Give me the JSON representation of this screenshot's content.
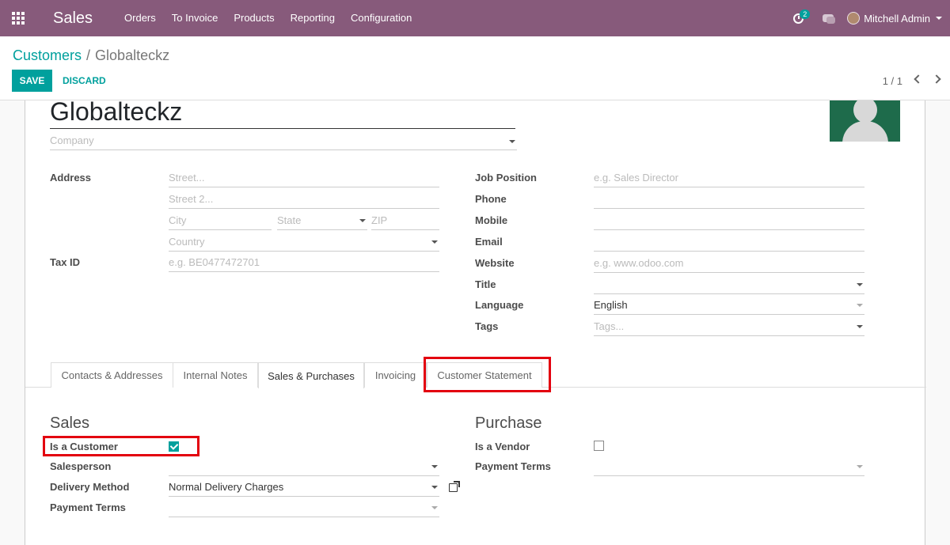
{
  "navbar": {
    "brand": "Sales",
    "menu": [
      "Orders",
      "To Invoice",
      "Products",
      "Reporting",
      "Configuration"
    ],
    "activity_count": "2",
    "user_name": "Mitchell Admin",
    "bg_color": "#875a7b"
  },
  "control_panel": {
    "breadcrumb_parent": "Customers",
    "breadcrumb_sep": "/",
    "breadcrumb_current": "Globalteckz",
    "save_label": "SAVE",
    "discard_label": "DISCARD",
    "pager": "1 / 1"
  },
  "form": {
    "name": "Globalteckz",
    "company_placeholder": "Company",
    "address_label": "Address",
    "street_placeholder": "Street...",
    "street2_placeholder": "Street 2...",
    "city_placeholder": "City",
    "state_placeholder": "State",
    "zip_placeholder": "ZIP",
    "country_placeholder": "Country",
    "tax_id_label": "Tax ID",
    "tax_id_placeholder": "e.g. BE0477472701",
    "job_position_label": "Job Position",
    "job_position_placeholder": "e.g. Sales Director",
    "phone_label": "Phone",
    "mobile_label": "Mobile",
    "email_label": "Email",
    "website_label": "Website",
    "website_placeholder": "e.g. www.odoo.com",
    "title_label": "Title",
    "language_label": "Language",
    "language_value": "English",
    "tags_label": "Tags",
    "tags_placeholder": "Tags..."
  },
  "tabs": [
    "Contacts & Addresses",
    "Internal Notes",
    "Sales & Purchases",
    "Invoicing",
    "Customer Statement"
  ],
  "active_tab": "Sales & Purchases",
  "sales": {
    "title": "Sales",
    "is_customer_label": "Is a Customer",
    "is_customer": true,
    "salesperson_label": "Salesperson",
    "delivery_method_label": "Delivery Method",
    "delivery_method_value": "Normal Delivery Charges",
    "payment_terms_label": "Payment Terms"
  },
  "purchase": {
    "title": "Purchase",
    "is_vendor_label": "Is a Vendor",
    "is_vendor": false,
    "payment_terms_label": "Payment Terms"
  },
  "colors": {
    "accent": "#00a09d",
    "highlight": "#e3000f"
  }
}
